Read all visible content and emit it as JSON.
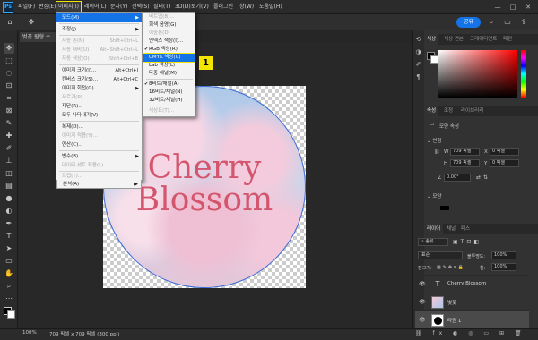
{
  "menubar": {
    "logo": "Ps",
    "items": [
      "파일(F)",
      "편집(E)",
      "이미지(I)",
      "레이어(L)",
      "문자(Y)",
      "선택(S)",
      "필터(T)",
      "3D(D)",
      "보기(V)",
      "플러그인",
      "창(W)",
      "도움말(H)"
    ],
    "active_item": "이미지(I)",
    "window_buttons": [
      "—",
      "□",
      "✕"
    ]
  },
  "optionsbar": {
    "share_label": "공유",
    "icons": [
      "home-icon",
      "move-icon",
      "search-icon",
      "workspace-icon",
      "share-icon"
    ]
  },
  "document": {
    "tab_label": "벚꽃 원형 스",
    "text_line1": "Cherry",
    "text_line2": "Blossom"
  },
  "image_menu": {
    "items": [
      {
        "label": "모드(M)",
        "shortcut": "",
        "submenu": true,
        "disabled": false,
        "highlight": true
      },
      {
        "label": "조정(J)",
        "shortcut": "",
        "submenu": true,
        "disabled": false,
        "highlight": false
      },
      {
        "label": "자동 톤(N)",
        "shortcut": "Shift+Ctrl+L",
        "submenu": false,
        "disabled": true,
        "highlight": false
      },
      {
        "label": "자동 대비(U)",
        "shortcut": "Alt+Shift+Ctrl+L",
        "submenu": false,
        "disabled": true,
        "highlight": false
      },
      {
        "label": "자동 색상(O)",
        "shortcut": "Shift+Ctrl+B",
        "submenu": false,
        "disabled": true,
        "highlight": false
      },
      {
        "label": "이미지 크기(I)...",
        "shortcut": "Alt+Ctrl+I",
        "submenu": false,
        "disabled": false,
        "highlight": false
      },
      {
        "label": "캔버스 크기(S)...",
        "shortcut": "Alt+Ctrl+C",
        "submenu": false,
        "disabled": false,
        "highlight": false
      },
      {
        "label": "이미지 회전(G)",
        "shortcut": "",
        "submenu": true,
        "disabled": false,
        "highlight": false
      },
      {
        "label": "자르기(P)",
        "shortcut": "",
        "submenu": false,
        "disabled": true,
        "highlight": false
      },
      {
        "label": "재단(R)...",
        "shortcut": "",
        "submenu": false,
        "disabled": false,
        "highlight": false
      },
      {
        "label": "모두 나타내기(V)",
        "shortcut": "",
        "submenu": false,
        "disabled": false,
        "highlight": false
      },
      {
        "label": "복제(D)...",
        "shortcut": "",
        "submenu": false,
        "disabled": false,
        "highlight": false
      },
      {
        "label": "이미지 적용(Y)...",
        "shortcut": "",
        "submenu": false,
        "disabled": true,
        "highlight": false
      },
      {
        "label": "연산(C)...",
        "shortcut": "",
        "submenu": false,
        "disabled": false,
        "highlight": false
      },
      {
        "label": "변수(B)",
        "shortcut": "",
        "submenu": true,
        "disabled": false,
        "highlight": false
      },
      {
        "label": "데이터 세트 적용(L)...",
        "shortcut": "",
        "submenu": false,
        "disabled": true,
        "highlight": false
      },
      {
        "label": "트랩(T)...",
        "shortcut": "",
        "submenu": false,
        "disabled": true,
        "highlight": false
      },
      {
        "label": "분석(A)",
        "shortcut": "",
        "submenu": true,
        "disabled": false,
        "highlight": false
      }
    ]
  },
  "mode_submenu": {
    "items": [
      {
        "label": "비트맵(B)...",
        "checked": false,
        "disabled": true,
        "highlight": false
      },
      {
        "label": "회색 음영(G)",
        "checked": false,
        "disabled": false,
        "highlight": false
      },
      {
        "label": "이중톤(D)",
        "checked": false,
        "disabled": true,
        "highlight": false
      },
      {
        "label": "인덱스 색상(I)...",
        "checked": false,
        "disabled": false,
        "highlight": false
      },
      {
        "label": "RGB 색상(R)",
        "checked": true,
        "disabled": false,
        "highlight": false
      },
      {
        "label": "CMYK 색상(C)",
        "checked": false,
        "disabled": false,
        "highlight": true
      },
      {
        "label": "Lab 색상(L)",
        "checked": false,
        "disabled": false,
        "highlight": false
      },
      {
        "label": "다중 채널(M)",
        "checked": false,
        "disabled": false,
        "highlight": false
      },
      {
        "label": "8비트/채널(A)",
        "checked": true,
        "disabled": false,
        "highlight": false
      },
      {
        "label": "16비트/채널(N)",
        "checked": false,
        "disabled": false,
        "highlight": false
      },
      {
        "label": "32비트/채널(H)",
        "checked": false,
        "disabled": false,
        "highlight": false
      },
      {
        "label": "색상표(T)...",
        "checked": false,
        "disabled": true,
        "highlight": false
      }
    ]
  },
  "callout": "1",
  "panels": {
    "color_tabs": [
      "색상",
      "색상 견본",
      "그레이디언트",
      "패턴"
    ],
    "props_tabs": [
      "속성",
      "조정",
      "라이브러리"
    ],
    "props_subtitle": "모양 속성",
    "transform_title": "변형",
    "w_label": "W",
    "h_label": "H",
    "x_label": "X",
    "y_label": "Y",
    "w_value": "709 픽셀",
    "h_value": "709 픽셀",
    "x_value": "0 픽셀",
    "y_value": "0 픽셀",
    "angle_value": "0.00°",
    "appearance_title": "모양",
    "layer_tabs": [
      "레이어",
      "채널",
      "패스"
    ],
    "layer_filter": "종류",
    "blend_mode": "표준",
    "opacity_label": "불투명도:",
    "opacity_value": "100%",
    "lock_label": "잠그기:",
    "fill_label": "칠:",
    "fill_value": "100%",
    "layers": [
      {
        "name": "Cherry Blossom",
        "type": "text"
      },
      {
        "name": "벚꽃",
        "type": "image"
      },
      {
        "name": "타원 1",
        "type": "shape"
      }
    ]
  },
  "status": {
    "zoom": "100%",
    "info": "709 픽셀 x 709 픽셀 (300 ppi)"
  },
  "colors": {
    "accent": "#1473e6",
    "callout": "#f2e600",
    "text_pink": "#d4566e"
  }
}
